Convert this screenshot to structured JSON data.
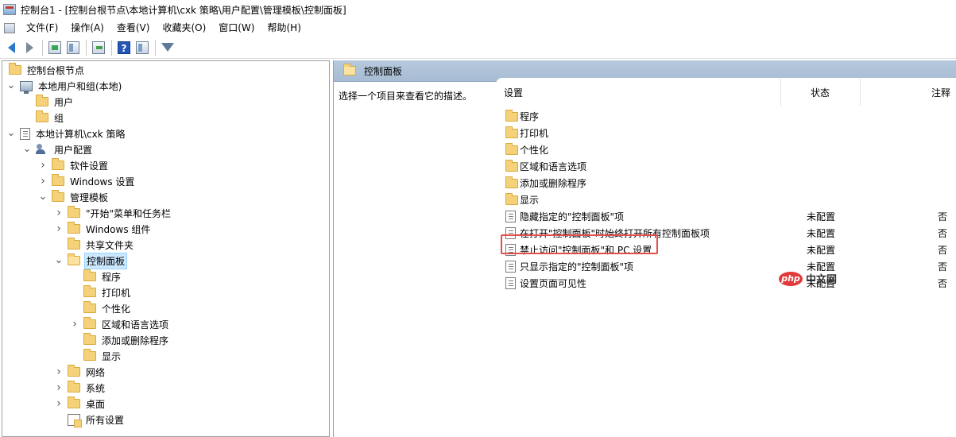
{
  "window": {
    "title": "控制台1 - [控制台根节点\\本地计算机\\cxk 策略\\用户配置\\管理模板\\控制面板]"
  },
  "menu": {
    "items": [
      "文件(F)",
      "操作(A)",
      "查看(V)",
      "收藏夹(O)",
      "窗口(W)",
      "帮助(H)"
    ]
  },
  "toolbar": {
    "buttons": [
      "back-icon",
      "forward-icon",
      "up-folder-icon",
      "show-hide-tree-icon",
      "export-list-icon",
      "help-icon",
      "show-hide-action-pane-icon",
      "filter-icon"
    ]
  },
  "tree": {
    "items": [
      {
        "label": "控制台根节点",
        "icon": "folder-icon",
        "expander": ""
      },
      {
        "label": "本地用户和组(本地)",
        "icon": "computer-users-icon",
        "expander": "expanded"
      },
      {
        "label": "用户",
        "icon": "folder-icon",
        "expander": ""
      },
      {
        "label": "组",
        "icon": "folder-icon",
        "expander": ""
      },
      {
        "label": "本地计算机\\cxk 策略",
        "icon": "policy-document-icon",
        "expander": "expanded"
      },
      {
        "label": "用户配置",
        "icon": "user-config-icon",
        "expander": "expanded"
      },
      {
        "label": "软件设置",
        "icon": "folder-icon",
        "expander": "collapsed"
      },
      {
        "label": "Windows 设置",
        "icon": "folder-icon",
        "expander": "collapsed"
      },
      {
        "label": "管理模板",
        "icon": "folder-icon",
        "expander": "expanded"
      },
      {
        "label": "\"开始\"菜单和任务栏",
        "icon": "folder-icon",
        "expander": "collapsed"
      },
      {
        "label": "Windows 组件",
        "icon": "folder-icon",
        "expander": "collapsed"
      },
      {
        "label": "共享文件夹",
        "icon": "folder-icon",
        "expander": ""
      },
      {
        "label": "控制面板",
        "icon": "folder-open-icon",
        "expander": "expanded",
        "selected": true
      },
      {
        "label": "程序",
        "icon": "folder-icon",
        "expander": ""
      },
      {
        "label": "打印机",
        "icon": "folder-icon",
        "expander": ""
      },
      {
        "label": "个性化",
        "icon": "folder-icon",
        "expander": ""
      },
      {
        "label": "区域和语言选项",
        "icon": "folder-icon",
        "expander": "collapsed"
      },
      {
        "label": "添加或删除程序",
        "icon": "folder-icon",
        "expander": ""
      },
      {
        "label": "显示",
        "icon": "folder-icon",
        "expander": ""
      },
      {
        "label": "网络",
        "icon": "folder-icon",
        "expander": "collapsed"
      },
      {
        "label": "系统",
        "icon": "folder-icon",
        "expander": "collapsed"
      },
      {
        "label": "桌面",
        "icon": "folder-icon",
        "expander": "collapsed"
      },
      {
        "label": "所有设置",
        "icon": "all-settings-icon",
        "expander": ""
      }
    ]
  },
  "right": {
    "header_title": "控制面板",
    "description": "选择一个项目来查看它的描述。",
    "columns": {
      "setting": "设置",
      "status": "状态",
      "note": "注释"
    },
    "rows": [
      {
        "icon": "folder-icon",
        "name": "程序",
        "status": "",
        "note": ""
      },
      {
        "icon": "folder-icon",
        "name": "打印机",
        "status": "",
        "note": ""
      },
      {
        "icon": "folder-icon",
        "name": "个性化",
        "status": "",
        "note": ""
      },
      {
        "icon": "folder-icon",
        "name": "区域和语言选项",
        "status": "",
        "note": ""
      },
      {
        "icon": "folder-icon",
        "name": "添加或删除程序",
        "status": "",
        "note": ""
      },
      {
        "icon": "folder-icon",
        "name": "显示",
        "status": "",
        "note": ""
      },
      {
        "icon": "policy-setting-icon",
        "name": "隐藏指定的\"控制面板\"项",
        "status": "未配置",
        "note": "否"
      },
      {
        "icon": "policy-setting-icon",
        "name": "在打开\"控制面板\"时始终打开所有控制面板项",
        "status": "未配置",
        "note": "否"
      },
      {
        "icon": "policy-setting-icon",
        "name": "禁止访问\"控制面板\"和 PC 设置",
        "status": "未配置",
        "note": "否"
      },
      {
        "icon": "policy-setting-icon",
        "name": "只显示指定的\"控制面板\"项",
        "status": "未配置",
        "note": "否"
      },
      {
        "icon": "policy-setting-icon",
        "name": "设置页面可见性",
        "status": "未配置",
        "note": "否"
      }
    ]
  },
  "watermark": {
    "logo": "php",
    "text": "中文网"
  },
  "colors": {
    "highlight": "#e0504a",
    "header_bg": "#b6c9dd",
    "selected_bg": "#cce8ff"
  }
}
